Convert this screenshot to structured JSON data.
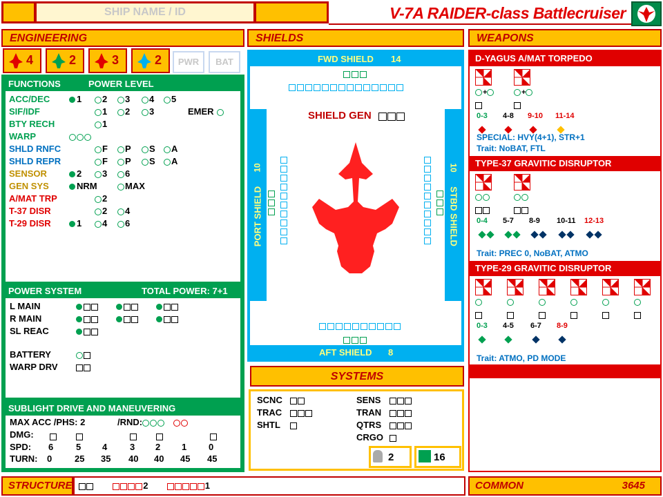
{
  "header": {
    "ship_name_placeholder": "SHIP NAME / ID",
    "title": "V-7A RAIDER-class Battlecruiser"
  },
  "sections": {
    "engineering": "ENGINEERING",
    "shields": "SHIELDS",
    "weapons": "WEAPONS",
    "systems": "SYSTEMS",
    "structure": "STRUCTURE",
    "common": "COMMON",
    "common_value": "3645"
  },
  "engineering": {
    "badges": [
      {
        "icon": "ship-icon",
        "value": "4"
      },
      {
        "icon": "arrow-up-icon",
        "value": "2"
      },
      {
        "icon": "turn-arrow-icon",
        "value": "3"
      },
      {
        "icon": "wrench-icon",
        "value": "2"
      }
    ],
    "pwr": "PWR",
    "bat": "BAT",
    "functions_label": "FUNCTIONS",
    "power_level_label": "POWER LEVEL",
    "rows": [
      {
        "label": "ACC/DEC",
        "cells": [
          "1",
          "2",
          "3",
          "4",
          "5"
        ]
      },
      {
        "label": "SIF/IDF",
        "cells": [
          "1",
          "2",
          "3"
        ],
        "emer": "EMER"
      },
      {
        "label": "BTY RECH",
        "cells": [
          "1"
        ]
      },
      {
        "label": "WARP"
      },
      {
        "label": "SHLD RNFC",
        "cells": [
          "F",
          "P",
          "S",
          "A"
        ]
      },
      {
        "label": "SHLD REPR",
        "cells": [
          "F",
          "P",
          "S",
          "A"
        ]
      },
      {
        "label": "SENSOR",
        "cells": [
          "2",
          "3",
          "6"
        ]
      },
      {
        "label": "GEN SYS",
        "cells": [
          "NRM",
          "MAX"
        ]
      },
      {
        "label": "A/MAT TRP",
        "cells": [
          "2"
        ]
      },
      {
        "label": "T-37 DISR",
        "cells": [
          "2",
          "4"
        ]
      },
      {
        "label": "T-29 DISR",
        "cells": [
          "1",
          "4",
          "6"
        ]
      }
    ]
  },
  "power_system": {
    "title": "POWER SYSTEM",
    "total": "TOTAL POWER: 7+1",
    "rows": [
      {
        "label": "L MAIN"
      },
      {
        "label": "R MAIN"
      },
      {
        "label": "SL REAC"
      },
      {
        "label": "BATTERY"
      },
      {
        "label": "WARP DRV"
      }
    ]
  },
  "sublight": {
    "title": "SUBLIGHT DRIVE AND MANEUVERING",
    "max_acc": "MAX ACC /PHS: 2",
    "rnd": "/RND:",
    "dmg_label": "DMG:",
    "spd_label": "SPD:",
    "turn_label": "TURN:",
    "spd": [
      "6",
      "5",
      "4",
      "3",
      "2",
      "1",
      "0"
    ],
    "turn": [
      "0",
      "25",
      "35",
      "40",
      "40",
      "45",
      "45"
    ]
  },
  "shields": {
    "fwd": "FWD SHIELD",
    "fwd_val": "14",
    "aft": "AFT SHIELD",
    "aft_val": "8",
    "port": "PORT SHIELD",
    "port_val": "10",
    "stbd": "STBD SHIELD",
    "stbd_val": "10",
    "gen": "SHIELD GEN"
  },
  "weapons": [
    {
      "name": "D-YAGUS A/MAT TORPEDO",
      "ranges": [
        "0-3",
        "4-8",
        "9-10",
        "11-14"
      ],
      "special": "SPECIAL: HVY(4+1), STR+1",
      "trait": "Trait: NoBAT, FTL"
    },
    {
      "name": "TYPE-37 GRAVITIC DISRUPTOR",
      "ranges": [
        "0-4",
        "5-7",
        "8-9",
        "10-11",
        "12-13"
      ],
      "trait": "Trait: PREC 0, NoBAT, ATMO"
    },
    {
      "name": "TYPE-29 GRAVITIC DISRUPTOR",
      "ranges": [
        "0-3",
        "4-5",
        "6-7",
        "8-9"
      ],
      "trait": "Trait: ATMO, PD MODE"
    }
  ],
  "systems": {
    "left": [
      {
        "label": "SCNC"
      },
      {
        "label": "TRAC"
      },
      {
        "label": "SHTL"
      }
    ],
    "right": [
      {
        "label": "SENS"
      },
      {
        "label": "TRAN"
      },
      {
        "label": "QTRS"
      },
      {
        "label": "CRGO"
      }
    ],
    "shuttles": "2",
    "crew": "16"
  },
  "structure": {
    "group1": "2",
    "group2": "1"
  }
}
